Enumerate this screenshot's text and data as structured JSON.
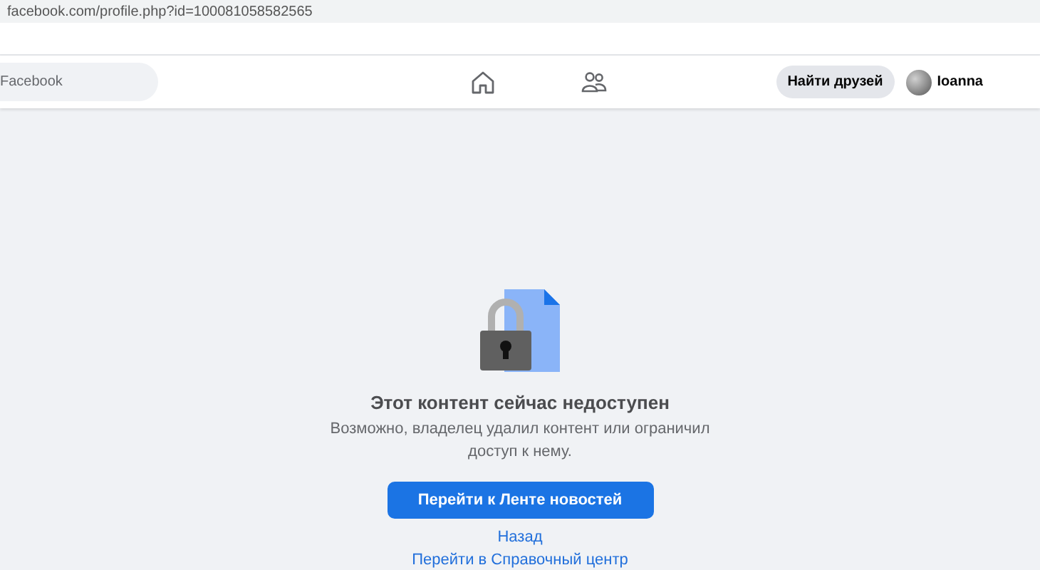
{
  "address_bar": {
    "url": "facebook.com/profile.php?id=100081058582565"
  },
  "navbar": {
    "search": {
      "placeholder": "Facebook"
    },
    "find_friends_button": "Найти друзей",
    "profile": {
      "name": "Ioanna"
    }
  },
  "message": {
    "title": "Этот контент сейчас недоступен",
    "body": "Возможно, владелец удалил контент или ограничил доступ к нему.",
    "primary_button": "Перейти к Ленте новостей",
    "links": [
      "Назад",
      "Перейти в Справочный центр"
    ]
  }
}
